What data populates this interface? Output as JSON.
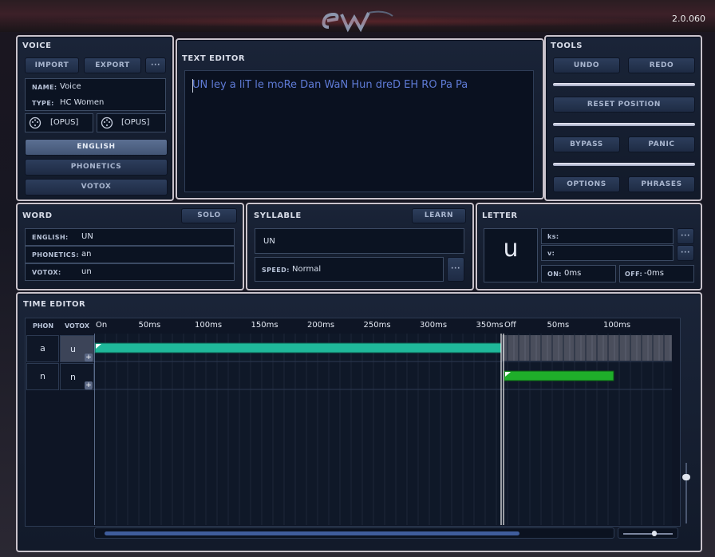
{
  "app": {
    "version": "2.0.060",
    "logo_text": "EW"
  },
  "voice": {
    "title": "VOICE",
    "import_label": "IMPORT",
    "export_label": "EXPORT",
    "more_label": "···",
    "name_label": "NAME:",
    "name_value": "Voice",
    "type_label": "TYPE:",
    "type_value": "HC Women",
    "midi_in": "[OPUS]",
    "midi_out": "[OPUS]",
    "modes": [
      "ENGLISH",
      "PHONETICS",
      "VOTOX"
    ],
    "active_mode": "ENGLISH"
  },
  "text_editor": {
    "title": "TEXT EDITOR",
    "text": "UN ley a liT le moRe Dan WaN Hun dreD EH RO Pa Pa"
  },
  "tools": {
    "title": "TOOLS",
    "undo": "UNDO",
    "redo": "REDO",
    "reset": "RESET POSITION",
    "bypass": "BYPASS",
    "panic": "PANIC",
    "options": "OPTIONS",
    "phrases": "PHRASES"
  },
  "word": {
    "title": "WORD",
    "solo": "SOLO",
    "english_label": "ENGLISH:",
    "english_value": "UN",
    "phonetics_label": "PHONETICS:",
    "phonetics_value": "an",
    "votox_label": "VOTOX:",
    "votox_value": "un"
  },
  "syllable": {
    "title": "SYLLABLE",
    "learn": "LEARN",
    "value": "UN",
    "speed_label": "SPEED:",
    "speed_value": "Normal",
    "more_label": "···"
  },
  "letter": {
    "title": "LETTER",
    "letter": "u",
    "ks_label": "ks:",
    "v_label": "v:",
    "on_label": "ON:",
    "on_value": "0ms",
    "off_label": "OFF:",
    "off_value": "-0ms",
    "more_label": "···"
  },
  "time_editor": {
    "title": "TIME EDITOR",
    "col_phon": "PHON",
    "col_votox": "VOTOX",
    "rows": [
      {
        "phon": "a",
        "votox": "u"
      },
      {
        "phon": "n",
        "votox": "n"
      }
    ],
    "ruler_on": [
      "On",
      "50ms",
      "100ms",
      "150ms",
      "200ms",
      "250ms",
      "300ms",
      "350ms"
    ],
    "ruler_off": [
      "Off",
      "50ms",
      "100ms"
    ],
    "colors": {
      "note_a": "#1fb89a",
      "note_n": "#1fae2a",
      "lane": "#4a4e5c"
    }
  }
}
